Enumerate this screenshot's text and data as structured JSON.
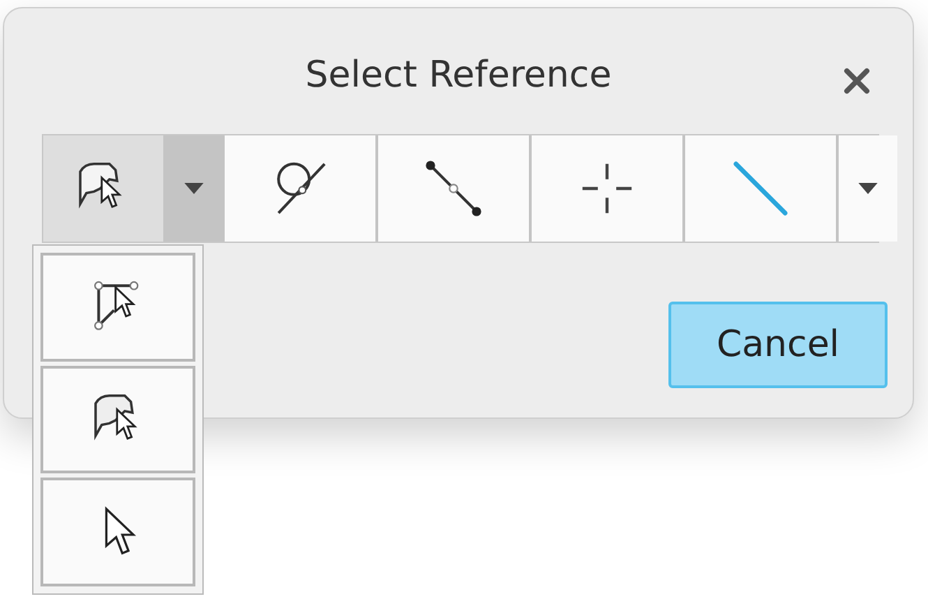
{
  "window": {
    "title": "Select Reference"
  },
  "toolbar": [
    {
      "kind": "surface-pick",
      "selected": true
    },
    {
      "kind": "menu-toggle",
      "selected": true
    },
    {
      "kind": "circle-line",
      "selected": false
    },
    {
      "kind": "points-line",
      "selected": false
    },
    {
      "kind": "crosshair",
      "selected": false
    },
    {
      "kind": "line",
      "selected": false
    },
    {
      "kind": "menu-toggle",
      "selected": false
    }
  ],
  "menu": {
    "expanded": true,
    "items": [
      {
        "kind": "corner-pick"
      },
      {
        "kind": "surface-pick"
      },
      {
        "kind": "arrow"
      }
    ]
  },
  "buttons": [
    {
      "label": "Cancel",
      "default": true
    }
  ]
}
